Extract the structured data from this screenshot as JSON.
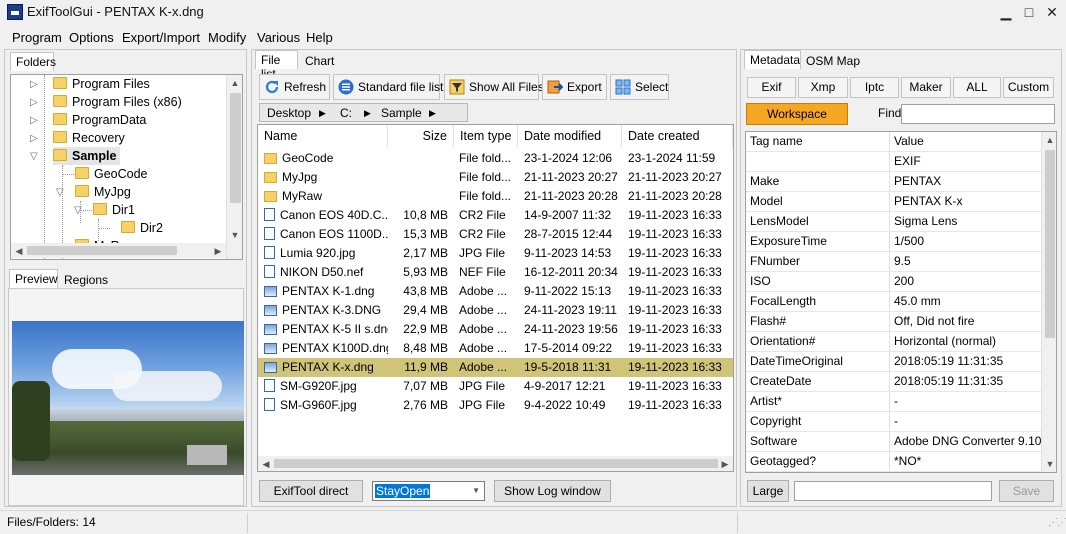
{
  "window": {
    "title": "ExifToolGui - PENTAX K-x.dng",
    "minimize": "▁",
    "maximize": "□",
    "close": "✕"
  },
  "menu": [
    "Program",
    "Options",
    "Export/Import",
    "Modify",
    "Various",
    "Help"
  ],
  "left": {
    "folders_tab": "Folders",
    "tree": [
      {
        "label": "Program Files"
      },
      {
        "label": "Program Files (x86)"
      },
      {
        "label": "ProgramData"
      },
      {
        "label": "Recovery"
      },
      {
        "label": "Sample"
      },
      {
        "label": "GeoCode"
      },
      {
        "label": "MyJpg"
      },
      {
        "label": "Dir1"
      },
      {
        "label": "Dir2"
      },
      {
        "label": "MyR..."
      }
    ],
    "preview_tabs": [
      "Preview",
      "Regions"
    ]
  },
  "middle": {
    "tabs": [
      "File list",
      "Chart"
    ],
    "toolbar": [
      "Refresh",
      "Standard file list",
      "Show All Files",
      "Export",
      "Select"
    ],
    "breadcrumb": [
      "Desktop",
      "C:",
      "Sample"
    ],
    "columns": [
      "Name",
      "Size",
      "Item type",
      "Date modified",
      "Date created"
    ],
    "files": [
      {
        "icon": "folder",
        "name": "GeoCode",
        "size": "",
        "type": "File fold...",
        "modified": "23-1-2024 12:06",
        "created": "23-1-2024 11:59"
      },
      {
        "icon": "folder",
        "name": "MyJpg",
        "size": "",
        "type": "File fold...",
        "modified": "21-11-2023 20:27",
        "created": "21-11-2023 20:27"
      },
      {
        "icon": "folder",
        "name": "MyRaw",
        "size": "",
        "type": "File fold...",
        "modified": "21-11-2023 20:28",
        "created": "21-11-2023 20:28"
      },
      {
        "icon": "doc",
        "name": "Canon EOS 40D.C...",
        "size": "10,8 MB",
        "type": "CR2 File",
        "modified": "14-9-2007 11:32",
        "created": "19-11-2023 16:33"
      },
      {
        "icon": "doc",
        "name": "Canon EOS 1100D...",
        "size": "15,3 MB",
        "type": "CR2 File",
        "modified": "28-7-2015 12:44",
        "created": "19-11-2023 16:33"
      },
      {
        "icon": "doc",
        "name": "Lumia 920.jpg",
        "size": "2,17 MB",
        "type": "JPG File",
        "modified": "9-11-2023 14:53",
        "created": "19-11-2023 16:33"
      },
      {
        "icon": "doc",
        "name": "NIKON D50.nef",
        "size": "5,93 MB",
        "type": "NEF File",
        "modified": "16-12-2011 20:34",
        "created": "19-11-2023 16:33"
      },
      {
        "icon": "img",
        "name": "PENTAX K-1.dng",
        "size": "43,8 MB",
        "type": "Adobe ...",
        "modified": "9-11-2022 15:13",
        "created": "19-11-2023 16:33"
      },
      {
        "icon": "img",
        "name": "PENTAX K-3.DNG",
        "size": "29,4 MB",
        "type": "Adobe ...",
        "modified": "24-11-2023 19:11",
        "created": "19-11-2023 16:33"
      },
      {
        "icon": "img",
        "name": "PENTAX K-5 II s.dng",
        "size": "22,9 MB",
        "type": "Adobe ...",
        "modified": "24-11-2023 19:56",
        "created": "19-11-2023 16:33"
      },
      {
        "icon": "img",
        "name": "PENTAX K100D.dng",
        "size": "8,48 MB",
        "type": "Adobe ...",
        "modified": "17-5-2014 09:22",
        "created": "19-11-2023 16:33"
      },
      {
        "icon": "img",
        "name": "PENTAX K-x.dng",
        "size": "11,9 MB",
        "type": "Adobe ...",
        "modified": "19-5-2018 11:31",
        "created": "19-11-2023 16:33",
        "selected": true
      },
      {
        "icon": "doc",
        "name": "SM-G920F.jpg",
        "size": "7,07 MB",
        "type": "JPG File",
        "modified": "4-9-2017 12:21",
        "created": "19-11-2023 16:33"
      },
      {
        "icon": "doc",
        "name": "SM-G960F.jpg",
        "size": "2,76 MB",
        "type": "JPG File",
        "modified": "9-4-2022 10:49",
        "created": "19-11-2023 16:33"
      }
    ],
    "bottom": {
      "exiftool_direct": "ExifTool direct",
      "stayopen": "StayOpen",
      "show_log": "Show Log window"
    }
  },
  "right": {
    "tabs": [
      "Metadata",
      "OSM Map"
    ],
    "filters": [
      "Exif",
      "Xmp",
      "Iptc",
      "Maker",
      "ALL",
      "Custom"
    ],
    "workspace": "Workspace",
    "find_label": "Find",
    "columns": [
      "Tag name",
      "Value"
    ],
    "rows": [
      {
        "tag": "",
        "value": "EXIF"
      },
      {
        "tag": "Make",
        "value": "PENTAX"
      },
      {
        "tag": "Model",
        "value": "PENTAX K-x"
      },
      {
        "tag": "LensModel",
        "value": "Sigma Lens"
      },
      {
        "tag": "ExposureTime",
        "value": "1/500"
      },
      {
        "tag": "FNumber",
        "value": "9.5"
      },
      {
        "tag": "ISO",
        "value": "200"
      },
      {
        "tag": "FocalLength",
        "value": "45.0 mm"
      },
      {
        "tag": "Flash#",
        "value": "Off, Did not fire"
      },
      {
        "tag": "Orientation#",
        "value": "Horizontal (normal)"
      },
      {
        "tag": "DateTimeOriginal",
        "value": "2018:05:19 11:31:35"
      },
      {
        "tag": "CreateDate",
        "value": "2018:05:19 11:31:35"
      },
      {
        "tag": "Artist*",
        "value": "-"
      },
      {
        "tag": "Copyright",
        "value": "-"
      },
      {
        "tag": "Software",
        "value": "Adobe DNG Converter 9.10"
      },
      {
        "tag": "Geotagged?",
        "value": "*NO*"
      }
    ],
    "large": "Large",
    "save": "Save"
  },
  "status": {
    "text": "Files/Folders: 14"
  },
  "colors": {
    "selection": "#cfc478",
    "workspace": "#f5a623"
  }
}
